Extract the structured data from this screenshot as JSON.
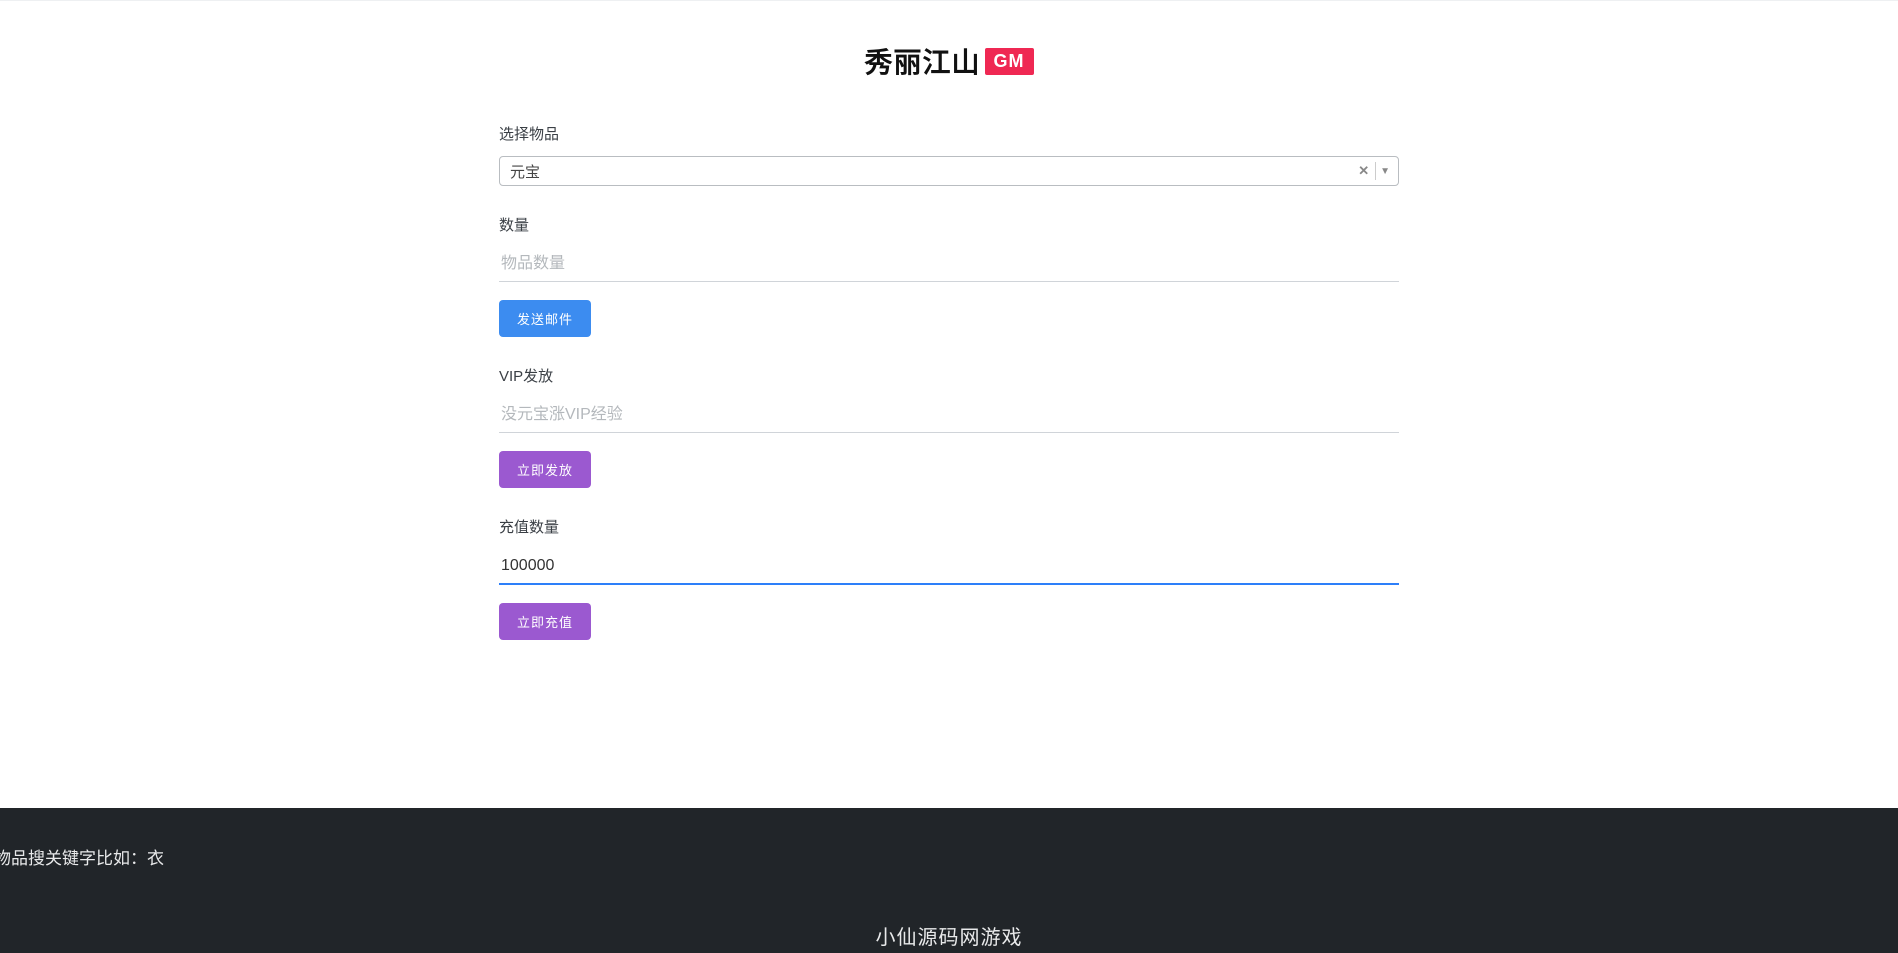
{
  "header": {
    "title": "秀丽江山",
    "badge": "GM"
  },
  "form": {
    "item_select": {
      "label": "选择物品",
      "value": "元宝"
    },
    "quantity": {
      "label": "数量",
      "placeholder": "物品数量",
      "value": ""
    },
    "send_mail_button": "发送邮件",
    "vip": {
      "label": "VIP发放",
      "placeholder": "没元宝涨VIP经验",
      "value": ""
    },
    "vip_button": "立即发放",
    "recharge": {
      "label": "充值数量",
      "value": "100000"
    },
    "recharge_button": "立即充值"
  },
  "footer": {
    "hint": "物品搜关键字比如：衣",
    "title": "小仙源码网游戏"
  }
}
